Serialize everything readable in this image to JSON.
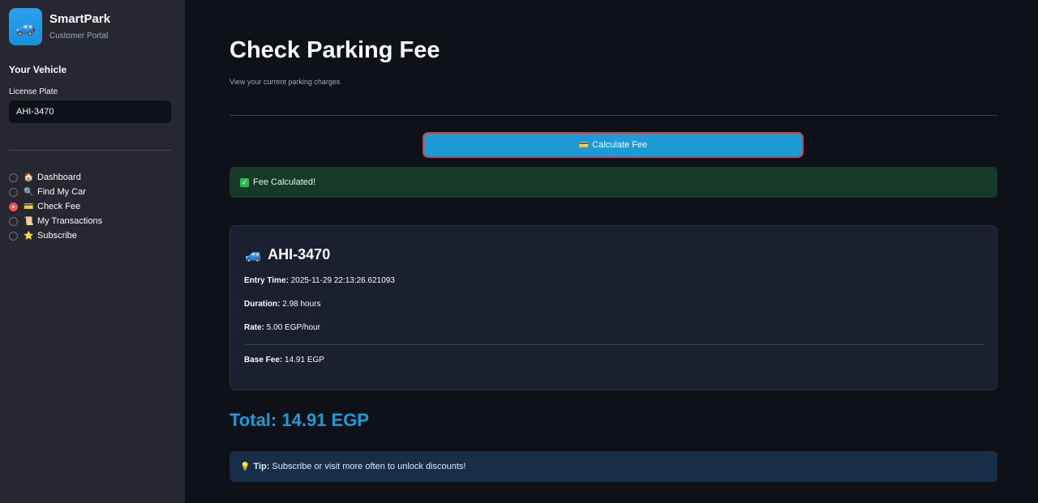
{
  "app": {
    "name": "SmartPark",
    "subtitle": "Customer Portal",
    "logo_icon": "🚙"
  },
  "sidebar": {
    "section_heading": "Your Vehicle",
    "plate_label": "License Plate",
    "plate_value": "AHI-3470",
    "nav": [
      {
        "icon": "🏠",
        "label": "Dashboard",
        "selected": false
      },
      {
        "icon": "🔍",
        "label": "Find My Car",
        "selected": false
      },
      {
        "icon": "💳",
        "label": "Check Fee",
        "selected": true
      },
      {
        "icon": "📜",
        "label": "My Transactions",
        "selected": false
      },
      {
        "icon": "⭐",
        "label": "Subscribe",
        "selected": false
      }
    ]
  },
  "page": {
    "title": "Check Parking Fee",
    "subtitle": "View your current parking charges"
  },
  "calc_button": {
    "icon": "💳",
    "label": "Calculate Fee"
  },
  "success": {
    "icon": "✓",
    "text": "Fee Calculated!"
  },
  "result": {
    "car_icon": "🚙",
    "plate": "AHI-3470",
    "entry_label": "Entry Time:",
    "entry_value": "2025-11-29 22:13:26.621093",
    "duration_label": "Duration:",
    "duration_value": "2.98 hours",
    "rate_label": "Rate:",
    "rate_value": "5.00 EGP/hour",
    "base_label": "Base Fee:",
    "base_value": "14.91 EGP"
  },
  "total": "Total: 14.91 EGP",
  "tip": {
    "icon": "💡",
    "label": "Tip:",
    "text": "Subscribe or visit more often to unlock discounts!"
  },
  "colors": {
    "accent": "#1e9ad6",
    "selected_radio": "#ff4b4b",
    "success_bg": "#173928",
    "tip_bg": "#172d48"
  }
}
